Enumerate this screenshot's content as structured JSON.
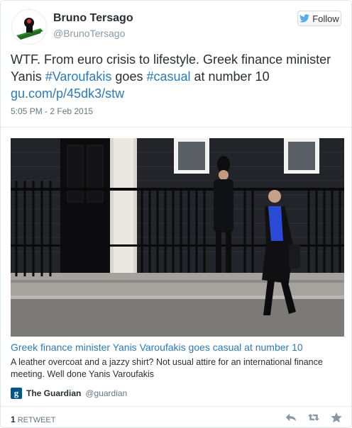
{
  "user": {
    "name": "Bruno Tersago",
    "handle": "@BrunoTersago"
  },
  "follow_label": "Follow",
  "tweet": {
    "t1": "WTF. From euro crisis to lifestyle. Greek finance minister",
    "t2": "Yanis ",
    "hash1": "#Varoufakis",
    "t3": " goes ",
    "hash2": "#casual",
    "t4": " at number 10",
    "link": "gu.com/p/45dk3/stw",
    "timestamp": "5:05 PM - 2 Feb 2015"
  },
  "card": {
    "title": "Greek finance minister Yanis Varoufakis goes casual at number 10",
    "description": "A leather overcoat and a jazzy shirt? Not usual attire for an international finance meeting. Well done Yanis Varoufakis",
    "source_name": "The Guardian",
    "source_handle": "@guardian",
    "source_logo": "g"
  },
  "footer": {
    "retweet_count": "1",
    "retweet_label": "RETWEET"
  },
  "colors": {
    "link": "#2b7bb9",
    "guardian": "#005689",
    "follow_bird": "#55acee"
  }
}
